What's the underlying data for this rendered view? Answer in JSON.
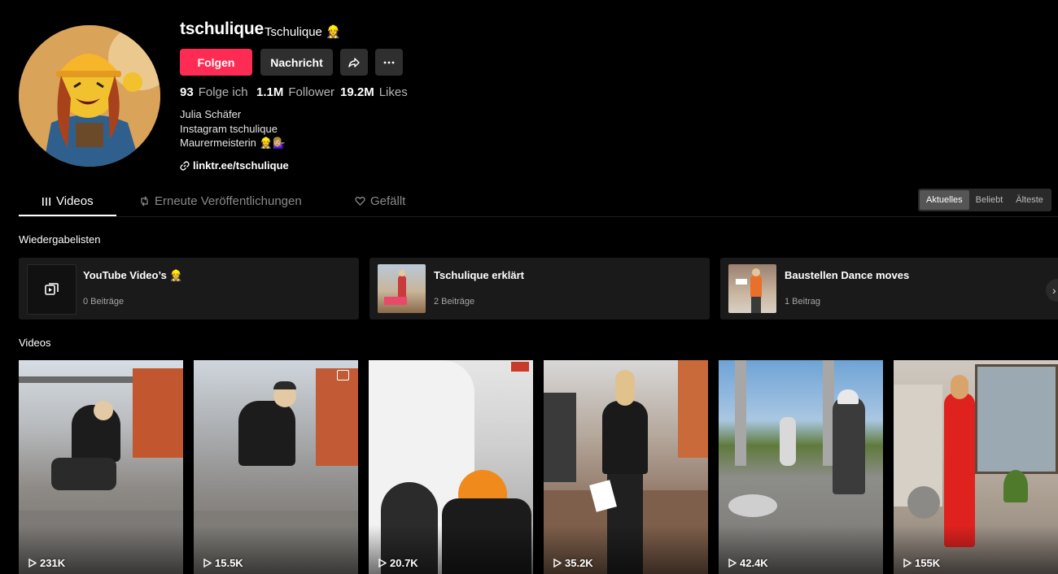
{
  "profile": {
    "username": "tschulique",
    "display_name": "Tschulique 👷‍♀️",
    "follow_label": "Folgen",
    "message_label": "Nachricht",
    "share_icon": "share-icon",
    "more_icon": "more-icon",
    "stats": {
      "following_count": "93",
      "following_label": "Folge ich",
      "followers_count": "1.1M",
      "followers_label": "Follower",
      "likes_count": "19.2M",
      "likes_label": "Likes"
    },
    "bio": [
      "Julia Schäfer",
      "Instagram tschulique",
      "Maurermeisterin 👷‍♀️💁🏼‍♀️"
    ],
    "link": "linktr.ee/tschulique"
  },
  "tabs": [
    {
      "label": "Videos",
      "icon": "grid-icon",
      "active": true
    },
    {
      "label": "Erneute Veröffentlichungen",
      "icon": "repost-icon",
      "active": false
    },
    {
      "label": "Gefällt",
      "icon": "heart-icon",
      "active": false
    }
  ],
  "sort": {
    "options": [
      "Aktuelles",
      "Beliebt",
      "Älteste"
    ],
    "selected": "Aktuelles"
  },
  "playlists": {
    "title": "Wiedergabelisten",
    "items": [
      {
        "name": "YouTube Video’s 👷‍♀️",
        "count": "0 Beiträge"
      },
      {
        "name": "Tschulique erklärt",
        "count": "2 Beiträge"
      },
      {
        "name": "Baustellen Dance moves",
        "count": "1 Beitrag"
      }
    ]
  },
  "videos": {
    "title": "Videos",
    "items": [
      {
        "views": "231K"
      },
      {
        "views": "15.5K"
      },
      {
        "views": "20.7K"
      },
      {
        "views": "35.2K"
      },
      {
        "views": "42.4K"
      },
      {
        "views": "155K"
      }
    ]
  },
  "colors": {
    "accent": "#fe2c55",
    "background": "#000000",
    "card": "#1a1a1a",
    "button_secondary": "#2f2f2f"
  }
}
